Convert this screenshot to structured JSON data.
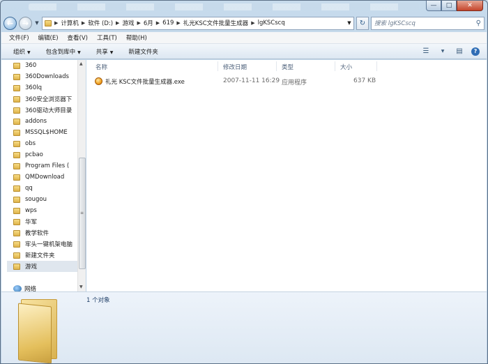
{
  "address": {
    "crumbs": [
      "计算机",
      "软件 (D:)",
      "游戏",
      "6月",
      "619",
      "礼光KSC文件批量生成器",
      "lgKSCscq"
    ]
  },
  "search": {
    "placeholder": "搜索 lgKSCscq"
  },
  "menu": [
    "文件(F)",
    "编辑(E)",
    "查看(V)",
    "工具(T)",
    "帮助(H)"
  ],
  "toolbar": {
    "organize": "组织",
    "include_in_library": "包含到库中",
    "share": "共享",
    "new_folder": "新建文件夹"
  },
  "tree": {
    "items": [
      "360",
      "360Downloads",
      "360lq",
      "360安全浏览器下",
      "360驱动大师目录",
      "addons",
      "MSSQL$HOME",
      "obs",
      "pcbao",
      "Program Files (",
      "QMDownload",
      "qq",
      "sougou",
      "wps",
      "华军",
      "教学软件",
      "牢头一键机架电脑",
      "新建文件夹",
      "游戏"
    ],
    "selected": "游戏",
    "network": "网络"
  },
  "columns": {
    "name": "名称",
    "date": "修改日期",
    "type": "类型",
    "size": "大小"
  },
  "files": [
    {
      "name": "礼光 KSC文件批量生成器.exe",
      "date": "2007-11-11 16:29",
      "type": "应用程序",
      "size": "637 KB"
    }
  ],
  "details": {
    "count": "1 个对象"
  },
  "colors": {
    "accent": "#2f6db5",
    "selection": "#dfe6ee"
  },
  "icons": [
    "back-icon",
    "forward-icon",
    "refresh-icon",
    "search-icon",
    "folder-icon",
    "network-icon",
    "help-icon",
    "exe-icon"
  ]
}
